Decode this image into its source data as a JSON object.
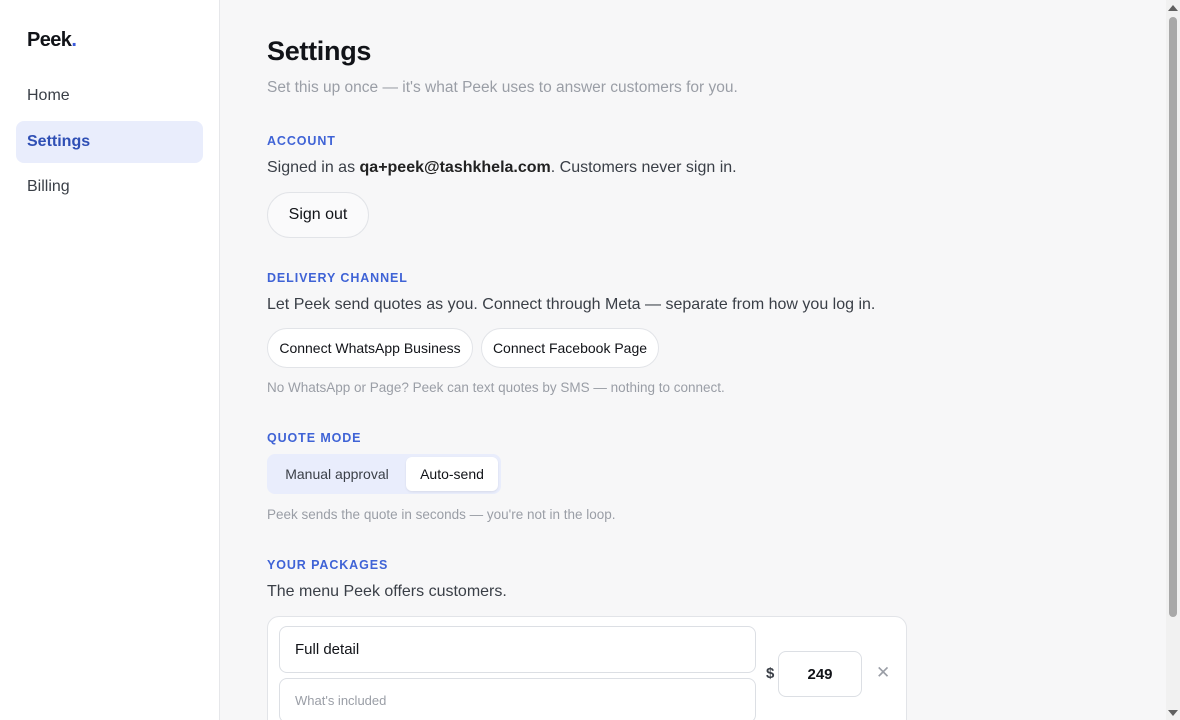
{
  "brand": {
    "name": "Peek",
    "dot": ".",
    "accent": "#3b5bdb"
  },
  "sidebar": {
    "items": [
      {
        "label": "Home",
        "active": false
      },
      {
        "label": "Settings",
        "active": true
      },
      {
        "label": "Billing",
        "active": false
      }
    ]
  },
  "page": {
    "title": "Settings",
    "subtitle": "Set this up once — it's what Peek uses to answer customers for you."
  },
  "account": {
    "label": "ACCOUNT",
    "prefix": "Signed in as ",
    "email": "qa+peek@tashkhela.com",
    "suffix": ". Customers never sign in.",
    "sign_out": "Sign out"
  },
  "delivery": {
    "label": "DELIVERY CHANNEL",
    "description": "Let Peek send quotes as you. Connect through Meta — separate from how you log in.",
    "whatsapp_button": "Connect WhatsApp Business",
    "facebook_button": "Connect Facebook Page",
    "hint": "No WhatsApp or Page? Peek can text quotes by SMS — nothing to connect."
  },
  "quote_mode": {
    "label": "QUOTE MODE",
    "options": [
      "Manual approval",
      "Auto-send"
    ],
    "selected": "Auto-send",
    "hint": "Peek sends the quote in seconds — you're not in the loop."
  },
  "packages": {
    "label": "YOUR PACKAGES",
    "description": "The menu Peek offers customers.",
    "currency": "$",
    "items": [
      {
        "name": "Full detail",
        "details_placeholder": "What's included",
        "price": "249"
      }
    ]
  }
}
